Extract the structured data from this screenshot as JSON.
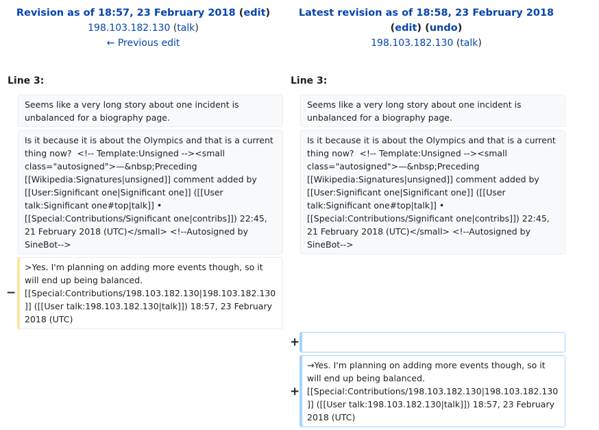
{
  "left_header": {
    "title_prefix": "Revision as of 18:57, 23 February 2018",
    "open_paren": "(",
    "edit_link": "edit",
    "close_paren": ")",
    "user_ip": "198.103.182.130",
    "talk_open": "(",
    "talk_link": "talk",
    "talk_close": ")",
    "previous_edit": "← Previous edit"
  },
  "right_header": {
    "title": "Latest revision as of 18:58, 23 February 2018",
    "edit_open": "(",
    "edit_link": "edit",
    "edit_close": ")",
    "undo_open": "(",
    "undo_link": "undo",
    "undo_close": ")",
    "user_ip": "198.103.182.130",
    "talk_open": "(",
    "talk_link": "talk",
    "talk_close": ")"
  },
  "left_line": "Line 3:",
  "right_line": "Line 3:",
  "left": {
    "context1": "Seems like a very long story about one incident is unbalanced for a biography page.",
    "context2": "Is it because it is about the Olympics and that is a current thing now?  <!-- Template:Unsigned --><small class=\"autosigned\">—&nbsp;Preceding [[Wikipedia:Signatures|unsigned]] comment added by [[User:Significant one|Significant one]] ([[User talk:Significant one#top|talk]] • [[Special:Contributions/Significant one|contribs]]) 22:45, 21 February 2018 (UTC)</small> <!--Autosigned by SineBot-->",
    "deleted": ">Yes. I'm planning on adding more events though, so it will end up being balanced. [[Special:Contributions/198.103.182.130|198.103.182.130]] ([[User talk:198.103.182.130|talk]]) 18:57, 23 February 2018 (UTC)",
    "minus_marker": "−"
  },
  "right": {
    "context1": "Seems like a very long story about one incident is unbalanced for a biography page.",
    "context2": "Is it because it is about the Olympics and that is a current thing now?  <!-- Template:Unsigned --><small class=\"autosigned\">—&nbsp;Preceding [[Wikipedia:Signatures|unsigned]] comment added by [[User:Significant one|Significant one]] ([[User talk:Significant one#top|talk]] • [[Special:Contributions/Significant one|contribs]]) 22:45, 21 February 2018 (UTC)</small> <!--Autosigned by SineBot-->",
    "added_empty": "",
    "added": "→Yes. I'm planning on adding more events though, so it will end up being balanced. [[Special:Contributions/198.103.182.130|198.103.182.130]] ([[User talk:198.103.182.130|talk]]) 18:57, 23 February 2018 (UTC)",
    "plus_marker_1": "+",
    "plus_marker_2": "+"
  },
  "colors": {
    "link": "#0645ad",
    "deleted_border": "#ffe49c",
    "added_border": "#a3d3ff",
    "context_bg": "#f8f9fa"
  }
}
